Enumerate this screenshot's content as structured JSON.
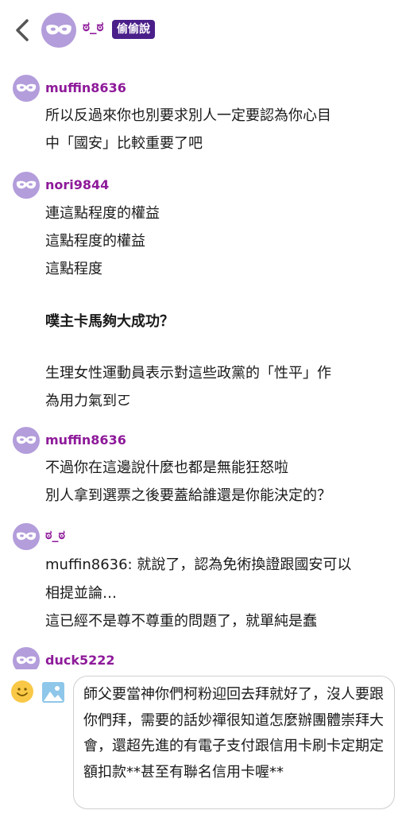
{
  "header": {
    "username": "ಠ_ಠ",
    "badge": "偷偷說"
  },
  "comments": [
    {
      "username": "muffin8636",
      "lines": [
        "所以反過來你也別要求別人一定要認為你心目",
        "中「國安」比較重要了吧"
      ]
    },
    {
      "username": "nori9844",
      "lines": [
        "連這點程度的權益",
        "這點程度的權益",
        "這點程度",
        "噗主卡馬夠大成功？",
        "生理女性運動員表示對這些政黨的「性平」作",
        "為用力氣到ㄛ"
      ]
    },
    {
      "username": "muffin8636",
      "lines": [
        "不過你在這邊說什麼也都是無能狂怒啦",
        "別人拿到選票之後要蓋給誰還是你能決定的？"
      ]
    },
    {
      "username": "ಠ_ಠ",
      "lines": [
        "muffin8636: 就說了，認為免術換證跟國安可以",
        "相提並論…",
        "這已經不是尊不尊重的問題了，就單純是蠢"
      ]
    },
    {
      "username": "duck5222",
      "lines": []
    }
  ],
  "composer": {
    "text": "師父要當神你們柯粉迎回去拜就好了，沒人要跟你們拜，需要的話妙禪很知道怎麼辦團體崇拜大會，還超先進的有電子支付跟信用卡刷卡定期定額扣款**甚至有聯名信用卡喔**"
  },
  "colors": {
    "username": "#8e1a9a",
    "badge_bg": "#4a1f8a",
    "avatar_bg": "#b39ddb"
  },
  "icons": [
    "back-arrow-icon",
    "mask-icon",
    "emoji-icon",
    "image-icon"
  ]
}
